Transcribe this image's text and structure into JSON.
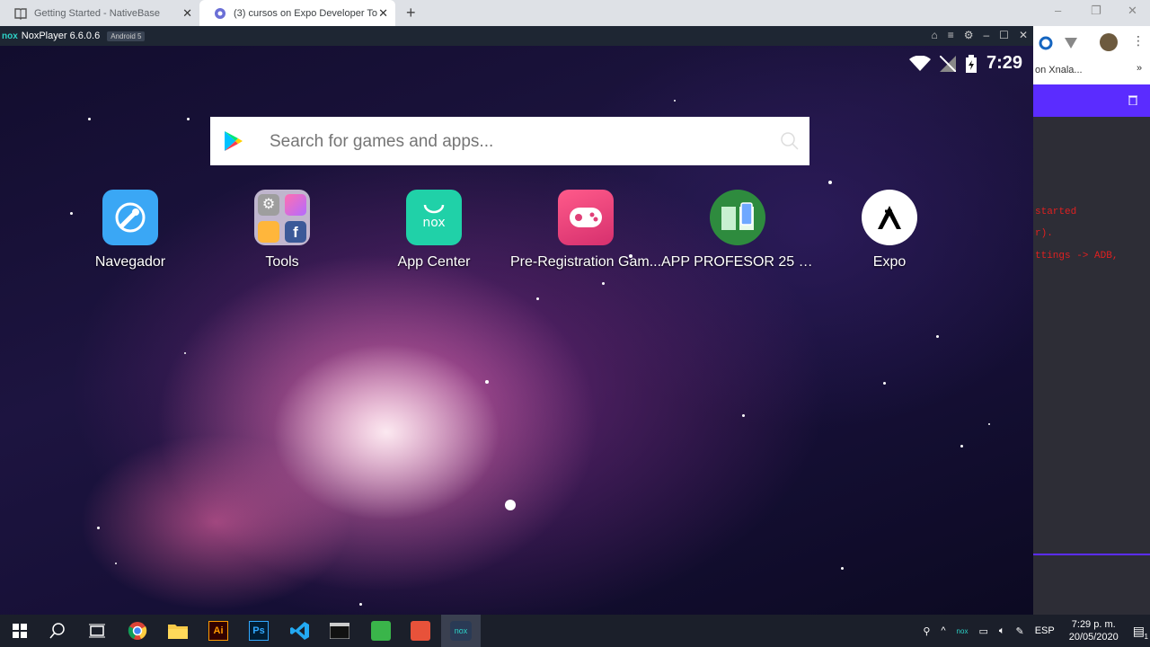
{
  "browser": {
    "tabs": [
      {
        "title": "Getting Started - NativeBase",
        "active": false
      },
      {
        "title": "(3) cursos on Expo Developer Too",
        "active": true
      }
    ],
    "new_tab": "+",
    "window_controls": {
      "minimize": "–",
      "restore": "❐",
      "close": "✕"
    },
    "bookmark_text": "on Xnala...",
    "bookmark_more": "»",
    "terminal_lines": [
      "started",
      "r).",
      "ttings -> ADB,"
    ]
  },
  "nox": {
    "logo": "nox",
    "title": "NoxPlayer 6.6.0.6",
    "badge": "Android 5",
    "controls": [
      "⌂",
      "≡",
      "⚙",
      "–",
      "☐",
      "✕"
    ]
  },
  "android": {
    "clock": "7:29",
    "search_placeholder": "Search for games and apps...",
    "apps": [
      {
        "label": "Navegador",
        "icon": "browser-icon",
        "color": "#3aa7f5"
      },
      {
        "label": "Tools",
        "icon": "tools-folder-icon",
        "color": "#c9c3d6"
      },
      {
        "label": "App Center",
        "icon": "nox-app-center-icon",
        "color": "#20d1a8"
      },
      {
        "label": "Pre-Registration Gam...",
        "icon": "gamepad-icon",
        "color": "#ec3f7a"
      },
      {
        "label": "APP PROFESOR 25 M...",
        "icon": "book-phone-icon",
        "color": "#2e8b3e"
      },
      {
        "label": "Expo",
        "icon": "expo-icon",
        "color": "#ffffff"
      }
    ]
  },
  "taskbar": {
    "lang": "ESP",
    "time": "7:29 p. m.",
    "date": "20/05/2020",
    "notif_count": "1"
  }
}
